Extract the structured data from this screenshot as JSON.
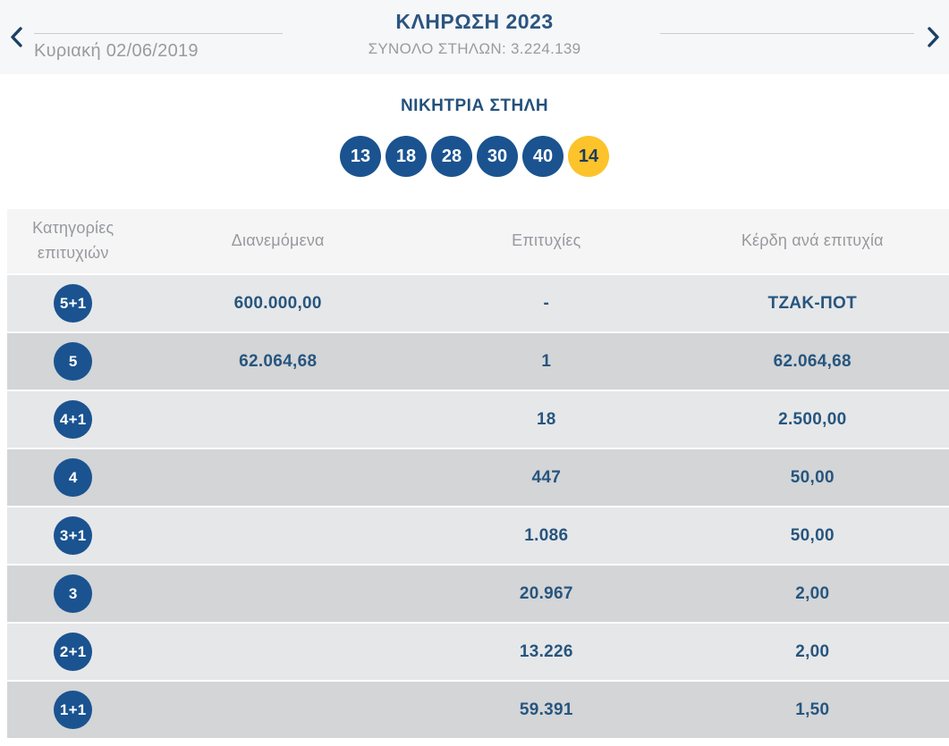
{
  "colors": {
    "primary_blue": "#1a5390",
    "text_blue": "#27557e",
    "joker_yellow": "#fcc32b",
    "top_header_bg": "#f6f7f8",
    "table_header_bg": "#f5f5f6",
    "row_light": "#e6e7e9",
    "row_dark": "#d3d5d7",
    "muted_text": "#97999d"
  },
  "icons": {
    "prev": "chevron-left",
    "next": "chevron-right"
  },
  "header": {
    "title": "ΚΛΗΡΩΣΗ 2023",
    "subtitle": "ΣΥΝΟΛΟ ΣΤΗΛΩΝ: 3.224.139",
    "date": "Κυριακή 02/06/2019"
  },
  "winning_column": {
    "title": "ΝΙΚΗΤΡΙΑ ΣΤΗΛΗ",
    "numbers": [
      "13",
      "18",
      "28",
      "30",
      "40"
    ],
    "joker": "14"
  },
  "results_table": {
    "columns": [
      "Κατηγορίες επιτυχιών",
      "Διανεμόμενα",
      "Επιτυχίες",
      "Κέρδη ανά επιτυχία"
    ],
    "rows": [
      {
        "category": "5+1",
        "distributed": "600.000,00",
        "winners": "-",
        "prize": "ΤΖΑΚ-ΠΟΤ"
      },
      {
        "category": "5",
        "distributed": "62.064,68",
        "winners": "1",
        "prize": "62.064,68"
      },
      {
        "category": "4+1",
        "distributed": "",
        "winners": "18",
        "prize": "2.500,00"
      },
      {
        "category": "4",
        "distributed": "",
        "winners": "447",
        "prize": "50,00"
      },
      {
        "category": "3+1",
        "distributed": "",
        "winners": "1.086",
        "prize": "50,00"
      },
      {
        "category": "3",
        "distributed": "",
        "winners": "20.967",
        "prize": "2,00"
      },
      {
        "category": "2+1",
        "distributed": "",
        "winners": "13.226",
        "prize": "2,00"
      },
      {
        "category": "1+1",
        "distributed": "",
        "winners": "59.391",
        "prize": "1,50"
      }
    ]
  }
}
